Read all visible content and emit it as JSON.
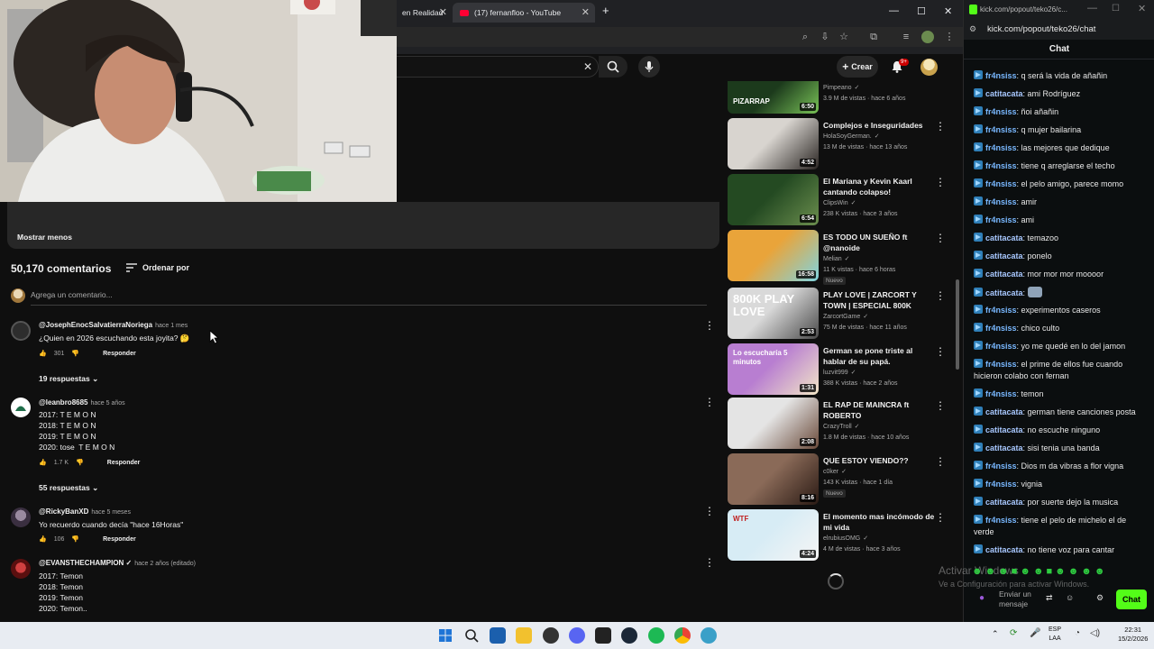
{
  "browser_tabs": [
    {
      "label": "en Realidad"
    },
    {
      "label": "(17) fernanfloo - YouTube"
    }
  ],
  "youtube": {
    "create_label": "Crear",
    "notifications_badge": "9+",
    "description_show_less": "Mostrar menos",
    "comments_count": "50,170 comentarios",
    "sort_label": "Ordenar por",
    "add_comment_placeholder": "Agrega un comentario...",
    "comments": [
      {
        "author": "@JosephEnocSalvatierraNoriega",
        "when": "hace 1 mes",
        "text": "¿Quien en 2026 escuchando esta joyita? 🤔",
        "likes": "301",
        "reply": "Responder",
        "replies": "19 respuestas"
      },
      {
        "author": "@leanbro8685",
        "when": "hace 5 años",
        "text": "2017: T E M O N\n2018: T E M O N\n2019: T E M O N\n2020: tose  T E M O N",
        "likes": "1.7 K",
        "reply": "Responder",
        "replies": "55 respuestas"
      },
      {
        "author": "@RickyBanXD",
        "when": "hace 5 meses",
        "text": "Yo recuerdo cuando decía \"hace 16Horas\"",
        "likes": "106",
        "reply": "Responder",
        "replies": ""
      },
      {
        "author": "@EVANSTHECHAMPION ✓",
        "when": "hace 2 años (editado)",
        "text": "2017: Temon\n2018: Temon\n2019: Temon\n2020: Temon..",
        "likes": "",
        "reply": "",
        "replies": ""
      }
    ],
    "related": [
      {
        "title": "",
        "channel": "Pimpeano",
        "meta": "3.9 M de vistas · hace 6 años",
        "duration": "6:50",
        "badge": "",
        "thumb_text": "PIZARRAP"
      },
      {
        "title": "Complejos e Inseguridades",
        "channel": "HolaSoyGerman.",
        "meta": "13 M de vistas · hace 13 años",
        "duration": "4:52",
        "badge": "",
        "thumb_text": ""
      },
      {
        "title": "El Mariana y Kevin Kaarl cantando colapso!",
        "channel": "ClipsWin",
        "meta": "238 K vistas · hace 3 años",
        "duration": "6:54",
        "badge": "",
        "thumb_text": ""
      },
      {
        "title": "ES TODO UN SUEÑO ft @nanoide",
        "channel": "Melian",
        "meta": "11 K vistas · hace 6 horas",
        "duration": "16:58",
        "badge": "Nuevo",
        "thumb_text": ""
      },
      {
        "title": "PLAY LOVE | ZARCORT Y TOWN | ESPECIAL 800K",
        "channel": "ZarcortGame",
        "meta": "75 M de vistas · hace 11 años",
        "duration": "2:53",
        "badge": "",
        "thumb_text": "800K PLAY LOVE"
      },
      {
        "title": "German se pone triste al hablar de su papá.",
        "channel": "luzvit999",
        "meta": "388 K vistas · hace 2 años",
        "duration": "1:31",
        "badge": "",
        "thumb_text": "Lo escucharía 5 minutos"
      },
      {
        "title": "EL RAP DE MAINCRA ft ROBERTO",
        "channel": "CrazyTroll",
        "meta": "1.8 M de vistas · hace 10 años",
        "duration": "2:08",
        "badge": "",
        "thumb_text": ""
      },
      {
        "title": "QUE ESTOY VIENDO??",
        "channel": "c0ker",
        "meta": "143 K vistas · hace 1 día",
        "duration": "8:16",
        "badge": "Nuevo",
        "thumb_text": ""
      },
      {
        "title": "El momento mas incómodo de mi vida",
        "channel": "elrubiusOMG",
        "meta": "4 M de vistas · hace 3 años",
        "duration": "4:24",
        "badge": "",
        "thumb_text": "WTF"
      }
    ]
  },
  "kick": {
    "url": "kick.com/popout/teko26/chat",
    "tab_title": "kick.com/popout/teko26/c...",
    "header": "Chat",
    "messages": [
      {
        "user": "fr4nsiss",
        "text": "q será la vida de añañin"
      },
      {
        "user": "catitacata",
        "text": "ami Rodríguez"
      },
      {
        "user": "fr4nsiss",
        "text": "ñoi añañin"
      },
      {
        "user": "fr4nsiss",
        "text": "q mujer bailarina"
      },
      {
        "user": "fr4nsiss",
        "text": "las mejores que dedique"
      },
      {
        "user": "fr4nsiss",
        "text": "tiene q arreglarse el techo"
      },
      {
        "user": "fr4nsiss",
        "text": "el pelo amigo, parece momo"
      },
      {
        "user": "fr4nsiss",
        "text": "amir"
      },
      {
        "user": "fr4nsiss",
        "text": "ami"
      },
      {
        "user": "catitacata",
        "text": "temazoo"
      },
      {
        "user": "catitacata",
        "text": "ponelo"
      },
      {
        "user": "catitacata",
        "text": "mor mor mor moooor"
      },
      {
        "user": "catitacata",
        "text": ""
      },
      {
        "user": "fr4nsiss",
        "text": "experimentos caseros"
      },
      {
        "user": "fr4nsiss",
        "text": "chico culto"
      },
      {
        "user": "fr4nsiss",
        "text": "yo me quedé en lo del jamon"
      },
      {
        "user": "fr4nsiss",
        "text": "el prime de ellos fue cuando hicieron colabo con fernan"
      },
      {
        "user": "fr4nsiss",
        "text": "temon"
      },
      {
        "user": "catitacata",
        "text": "german tiene canciones posta"
      },
      {
        "user": "catitacata",
        "text": "no escuche ninguno"
      },
      {
        "user": "catitacata",
        "text": "sisi tenia una banda"
      },
      {
        "user": "fr4nsiss",
        "text": "Dios m da vibras a flor vigna"
      },
      {
        "user": "fr4nsiss",
        "text": "vignia"
      },
      {
        "user": "catitacata",
        "text": "por suerte dejo la musica"
      },
      {
        "user": "fr4nsiss",
        "text": "tiene el pelo de michelo el de verde"
      },
      {
        "user": "catitacata",
        "text": "no tiene voz para cantar"
      }
    ],
    "input_placeholder": "Enviar un mensaje",
    "chat_button": "Chat"
  },
  "watermark": {
    "line1": "Activar Windows",
    "line2": "Ve a Configuración para activar Windows."
  },
  "tray": {
    "lang1": "ESP",
    "lang2": "LAA",
    "time": "22:31",
    "date": "15/2/2026"
  },
  "colors": {
    "kick_green": "#53fc18",
    "yt_red": "#ff0033",
    "yt_bg": "#0f0f0f"
  }
}
